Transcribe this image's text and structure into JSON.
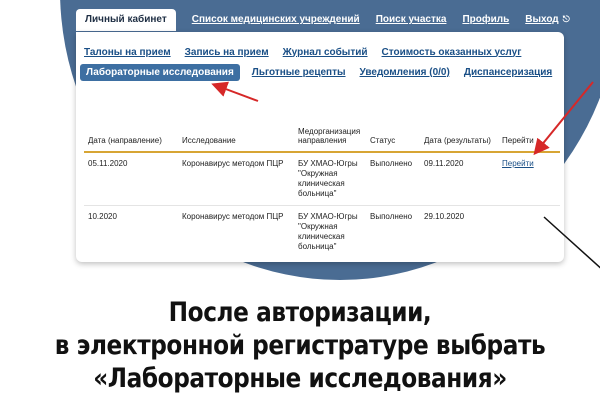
{
  "topnav": {
    "active_tab": "Личный кабинет",
    "links": [
      "Список медицинских учреждений",
      "Поиск участка",
      "Профиль",
      "Выход"
    ]
  },
  "subnav": {
    "row1": [
      "Талоны на прием",
      "Запись на прием",
      "Журнал событий",
      "Стоимость оказанных услуг"
    ],
    "active": "Лабораторные исследования",
    "row2": [
      "Льготные рецепты",
      "Уведомления (0/0)",
      "Диспансеризация"
    ]
  },
  "table": {
    "headers": [
      "Дата (направление)",
      "Исследование",
      "Медорганизация направления",
      "Статус",
      "Дата (результаты)",
      "Перейти"
    ],
    "rows": [
      {
        "date_dir": "05.11.2020",
        "study": "Коронавирус методом ПЦР",
        "org": "БУ ХМАО-Югры \"Окружная клиническая больница\"",
        "status": "Выполнено",
        "date_res": "09.11.2020",
        "goto": "Перейти"
      },
      {
        "date_dir": "10.2020",
        "study": "Коронавирус методом ПЦР",
        "org": "БУ ХМАО-Югры \"Окружная клиническая больница\"",
        "status": "Выполнено",
        "date_res": "29.10.2020",
        "goto": ""
      }
    ]
  },
  "caption": {
    "line1": "После авторизации,",
    "line2": "в электронной регистратуре выбрать",
    "line3": "«Лабораторные исследования»"
  },
  "colors": {
    "bg_blue": "#4a6c93",
    "arrow_red": "#d62828",
    "header_rule": "#d7a534",
    "link": "#1a4f86",
    "active_sub": "#3d6fa2"
  }
}
